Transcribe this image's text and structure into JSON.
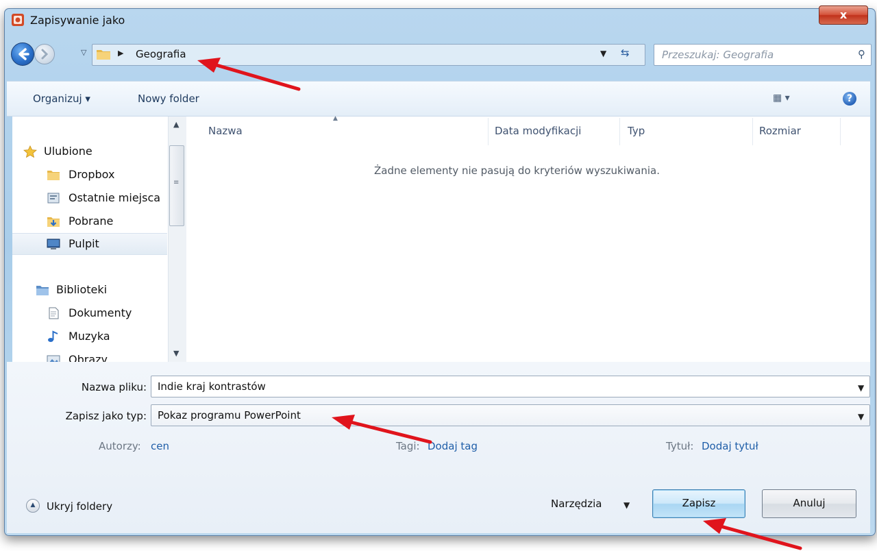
{
  "window": {
    "title": "Zapisywanie jako",
    "close_label": "x"
  },
  "address": {
    "current_folder": "Geografia",
    "search_placeholder": "Przeszukaj: Geografia"
  },
  "toolbar": {
    "organize_label": "Organizuj ▾",
    "new_folder_label": "Nowy folder",
    "view_label": "▦ ▾",
    "help_label": "?"
  },
  "navigation": {
    "favorites_header": "Ulubione",
    "favorites": [
      {
        "label": "Dropbox",
        "icon": "folder-icon"
      },
      {
        "label": "Ostatnie miejsca",
        "icon": "recent-places-icon"
      },
      {
        "label": "Pobrane",
        "icon": "downloads-icon"
      },
      {
        "label": "Pulpit",
        "icon": "desktop-icon"
      }
    ],
    "libraries_header": "Biblioteki",
    "libraries": [
      {
        "label": "Dokumenty",
        "icon": "documents-icon"
      },
      {
        "label": "Muzyka",
        "icon": "music-icon"
      },
      {
        "label": "Obrazy",
        "icon": "pictures-icon"
      }
    ]
  },
  "file_list": {
    "columns": [
      "Nazwa",
      "Data modyfikacji",
      "Typ",
      "Rozmiar"
    ],
    "empty_message": "Żadne elementy nie pasują do kryteriów wyszukiwania."
  },
  "form": {
    "filename_label": "Nazwa pliku:",
    "filename_value": "Indie kraj kontrastów",
    "type_label": "Zapisz jako typ:",
    "type_value": "Pokaz programu PowerPoint",
    "authors_label": "Autorzy:",
    "authors_value": "cen",
    "tags_label": "Tagi:",
    "tags_value": "Dodaj tag",
    "title_label": "Tytuł:",
    "title_value": "Dodaj tytuł"
  },
  "footer": {
    "hide_folders_label": "Ukryj foldery",
    "tools_label": "Narzędzia",
    "save_label": "Zapisz",
    "cancel_label": "Anuluj"
  },
  "colors": {
    "annotation_arrow": "#e0141c",
    "link": "#1f5ea8",
    "window_frame": "#a9cdea"
  }
}
